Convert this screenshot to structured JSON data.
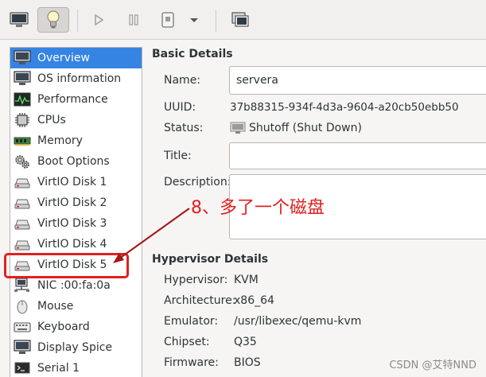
{
  "toolbar": {
    "buttons": [
      {
        "name": "console-icon"
      },
      {
        "name": "lightbulb-icon"
      },
      {
        "name": "play-icon"
      },
      {
        "name": "pause-icon"
      },
      {
        "name": "shutdown-icon"
      },
      {
        "name": "chevron-down-icon"
      },
      {
        "name": "fullscreen-icon"
      }
    ]
  },
  "sidebar": {
    "items": [
      {
        "label": "Overview",
        "icon": "monitor-icon",
        "selected": true
      },
      {
        "label": "OS information",
        "icon": "monitor-icon"
      },
      {
        "label": "Performance",
        "icon": "performance-icon"
      },
      {
        "label": "CPUs",
        "icon": "cpu-icon"
      },
      {
        "label": "Memory",
        "icon": "memory-icon"
      },
      {
        "label": "Boot Options",
        "icon": "gear-icon"
      },
      {
        "label": "VirtIO Disk 1",
        "icon": "disk-icon"
      },
      {
        "label": "VirtIO Disk 2",
        "icon": "disk-icon"
      },
      {
        "label": "VirtIO Disk 3",
        "icon": "disk-icon"
      },
      {
        "label": "VirtIO Disk 4",
        "icon": "disk-icon"
      },
      {
        "label": "VirtIO Disk 5",
        "icon": "disk-icon"
      },
      {
        "label": "NIC :00:fa:0a",
        "icon": "network-icon"
      },
      {
        "label": "Mouse",
        "icon": "mouse-icon"
      },
      {
        "label": "Keyboard",
        "icon": "keyboard-icon"
      },
      {
        "label": "Display Spice",
        "icon": "monitor-icon"
      },
      {
        "label": "Serial 1",
        "icon": "serial-icon"
      }
    ]
  },
  "basic": {
    "title": "Basic Details",
    "name_label": "Name:",
    "name_value": "servera",
    "uuid_label": "UUID:",
    "uuid_value": "37b88315-934f-4d3a-9604-a20cb50ebb50",
    "status_label": "Status:",
    "status_value": "Shutoff (Shut Down)",
    "title_label": "Title:",
    "title_value": "",
    "desc_label": "Description:",
    "desc_value": ""
  },
  "hypervisor": {
    "title": "Hypervisor Details",
    "rows": [
      {
        "label": "Hypervisor:",
        "value": "KVM"
      },
      {
        "label": "Architecture:",
        "value": "x86_64"
      },
      {
        "label": "Emulator:",
        "value": "/usr/libexec/qemu-kvm"
      },
      {
        "label": "Chipset:",
        "value": "Q35"
      },
      {
        "label": "Firmware:",
        "value": "BIOS"
      }
    ]
  },
  "annotation": {
    "text": "8、多了一个磁盘",
    "color": "#e02020"
  },
  "watermark": "CSDN @艾特NND"
}
